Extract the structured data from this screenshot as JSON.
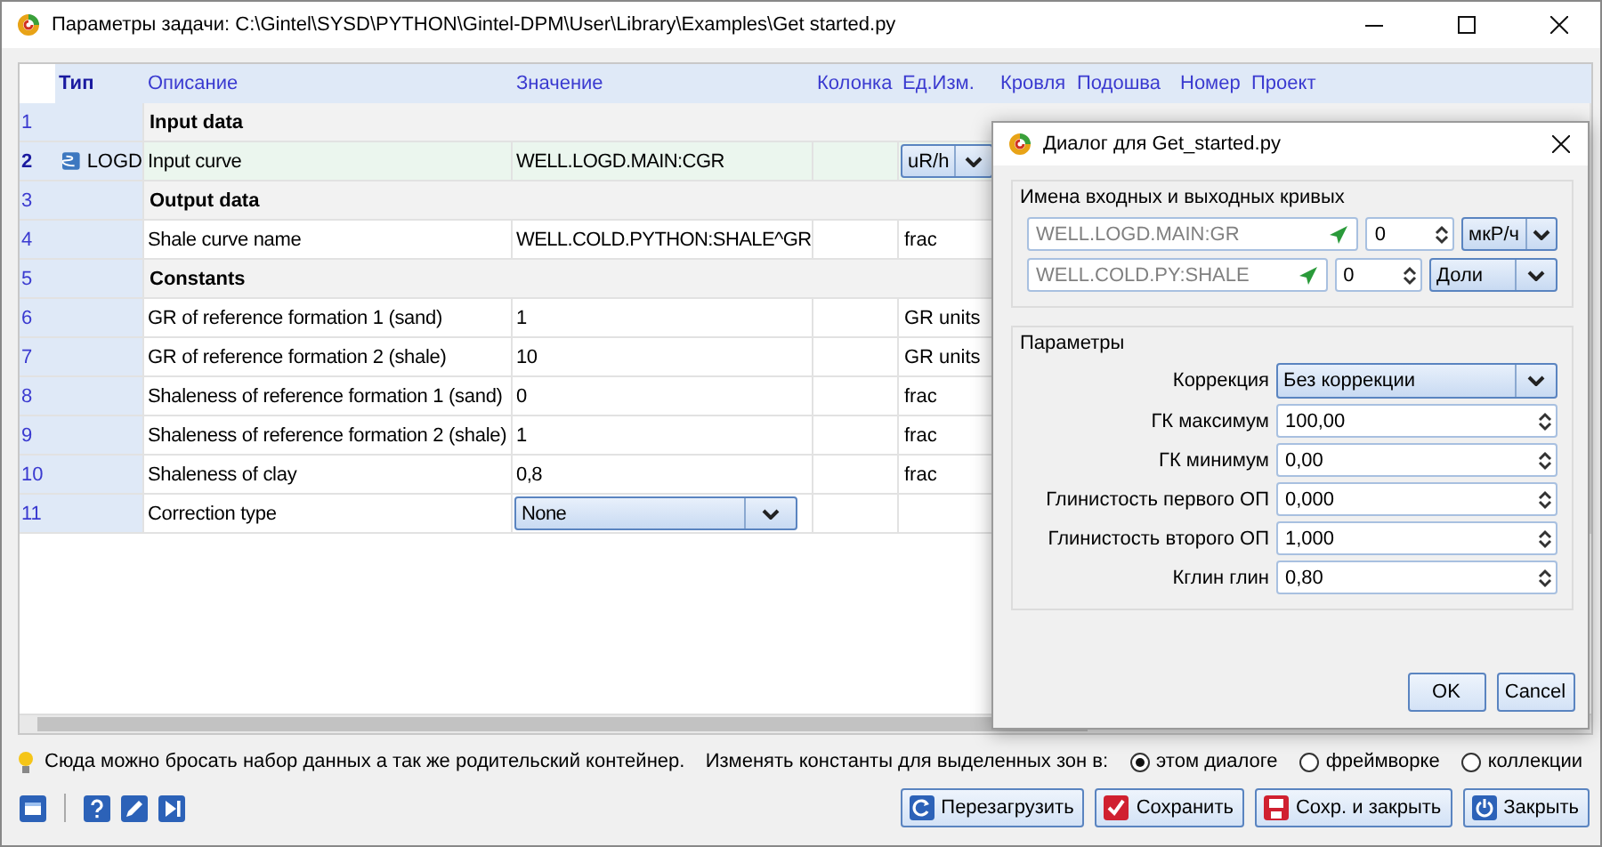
{
  "window": {
    "title": "Параметры задачи: C:\\Gintel\\SYSD\\PYTHON\\Gintel-DPM\\User\\Library\\Examples\\Get started.py"
  },
  "table": {
    "columns": [
      "Тип",
      "Описание",
      "Значение",
      "Колонка",
      "Ед.Изм.",
      "Кровля",
      "Подошва",
      "Номер",
      "Проект"
    ],
    "rows": [
      {
        "number": "1",
        "kind": "section",
        "description": "Input data",
        "selected": false
      },
      {
        "number": "2",
        "kind": "param",
        "type": "LOGD",
        "description": "Input curve",
        "value": "WELL.LOGD.MAIN:CGR",
        "unit_dropdown": "uR/h",
        "selected": true
      },
      {
        "number": "3",
        "kind": "section",
        "description": "Output data",
        "selected": false
      },
      {
        "number": "4",
        "kind": "param",
        "description": "Shale curve name",
        "value": "WELL.COLD.PYTHON:SHALE^GR",
        "unit": "frac",
        "selected": false
      },
      {
        "number": "5",
        "kind": "section",
        "description": "Constants",
        "selected": false
      },
      {
        "number": "6",
        "kind": "param",
        "description": "GR of reference formation 1 (sand)",
        "value": "1",
        "unit": "GR units",
        "selected": false
      },
      {
        "number": "7",
        "kind": "param",
        "description": "GR of reference formation 2 (shale)",
        "value": "10",
        "unit": "GR units",
        "selected": false
      },
      {
        "number": "8",
        "kind": "param",
        "description": "Shaleness of reference formation 1 (sand)",
        "value": "0",
        "unit": "frac",
        "selected": false
      },
      {
        "number": "9",
        "kind": "param",
        "description": "Shaleness of reference formation 2 (shale)",
        "value": "1",
        "unit": "frac",
        "selected": false
      },
      {
        "number": "10",
        "kind": "param",
        "description": "Shaleness of clay",
        "value": "0,8",
        "unit": "frac",
        "selected": false
      },
      {
        "number": "11",
        "kind": "param",
        "description": "Correction type",
        "value_dropdown": "None",
        "selected": false
      }
    ]
  },
  "status": {
    "hint": "Сюда можно бросать набор данных а так же родительский контейнер.",
    "radio_label": "Изменять константы для выделенных зон в:",
    "options": [
      {
        "label": "этом диалоге",
        "selected": true
      },
      {
        "label": "фреймворке",
        "selected": false
      },
      {
        "label": "коллекции",
        "selected": false
      }
    ]
  },
  "buttons": [
    {
      "label": "Перезагрузить",
      "kind": "reload"
    },
    {
      "label": "Сохранить",
      "kind": "save"
    },
    {
      "label": "Сохр. и закрыть",
      "kind": "save_close"
    },
    {
      "label": "Закрыть",
      "kind": "close"
    }
  ],
  "dialog": {
    "title": "Диалог для Get_started.py",
    "curves": {
      "legend": "Имена входных и выходных кривых",
      "rows": [
        {
          "name": "WELL.LOGD.MAIN:GR",
          "number": "0",
          "unit": "мкР/ч"
        },
        {
          "name": "WELL.COLD.PY:SHALE",
          "number": "0",
          "unit": "Доли"
        }
      ]
    },
    "params": {
      "legend": "Параметры",
      "rows": [
        {
          "label": "Коррекция",
          "value": "Без коррекции",
          "kind": "combo"
        },
        {
          "label": "ГК максимум",
          "value": "100,00",
          "kind": "spin"
        },
        {
          "label": "ГК минимум",
          "value": "0,00",
          "kind": "spin"
        },
        {
          "label": "Глинистость первого ОП",
          "value": "0,000",
          "kind": "spin"
        },
        {
          "label": "Глинистость второго ОП",
          "value": "1,000",
          "kind": "spin"
        },
        {
          "label": "Кглин глин",
          "value": "0,80",
          "kind": "spin"
        }
      ]
    },
    "buttons": [
      "OK",
      "Cancel"
    ]
  }
}
